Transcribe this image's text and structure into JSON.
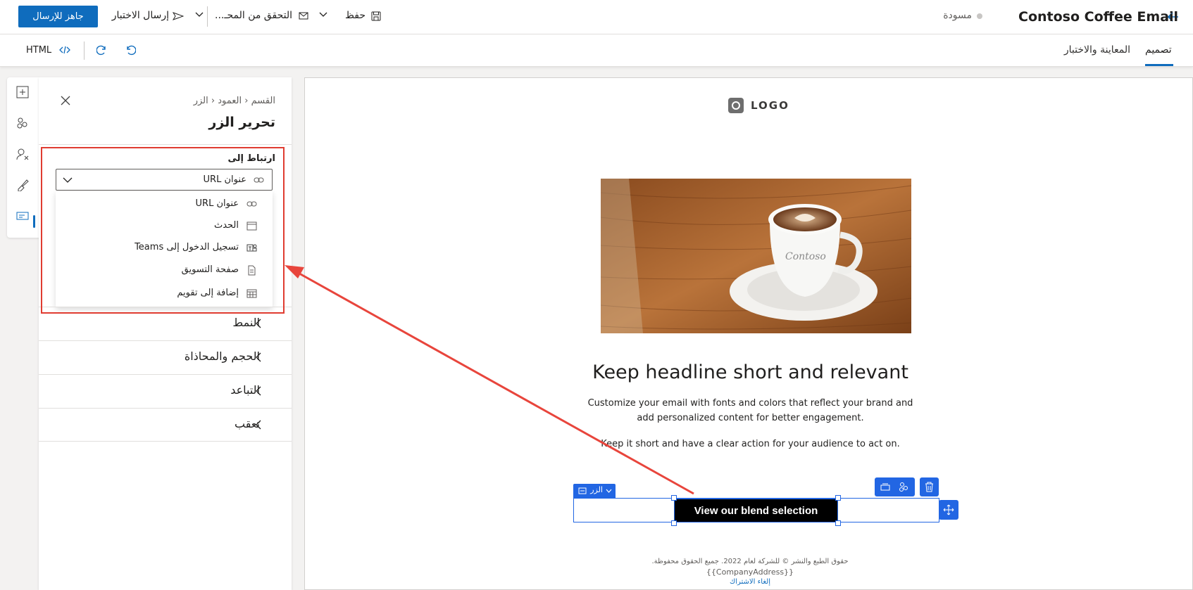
{
  "header": {
    "title": "Contoso Coffee Email",
    "status": "مسودة",
    "save_label": "حفظ",
    "check_label": "التحقق من المحـ...",
    "send_test_label": "إرسال الاختبار",
    "ready_label": "جاهز للإرسال"
  },
  "tabs": {
    "design": "تصميم",
    "preview": "المعاينة والاختبار"
  },
  "toolbar": {
    "html_label": "HTML"
  },
  "panel": {
    "breadcrumb": {
      "section": "القسم",
      "column": "العمود",
      "button": "الزر"
    },
    "title": "تحرير الزر",
    "link_to_label": "ارتباط إلى",
    "selected_value": "عنوان URL",
    "options": [
      {
        "label": "عنوان URL",
        "icon": "link-icon"
      },
      {
        "label": "الحدث",
        "icon": "calendar-icon"
      },
      {
        "label": "تسجيل الدخول إلى Teams",
        "icon": "teams-icon"
      },
      {
        "label": "صفحة التسويق",
        "icon": "document-icon"
      },
      {
        "label": "إضافة إلى تقويم",
        "icon": "calendar-grid-icon"
      }
    ],
    "sections": [
      "النمط",
      "الحجم والمحاذاة",
      "التباعد",
      "تعقب"
    ]
  },
  "email": {
    "logo_text": "LOGO",
    "headline": "Keep headline short and relevant",
    "body1": "Customize your email with fonts and colors that reflect your brand and add personalized content for better engagement.",
    "body2": "Keep it short and have a clear action for your audience to act on.",
    "button_label": "View our blend selection",
    "element_tag": "الزر",
    "footer_copyright": "حقوق الطبع والنشر © للشركة لعام 2022. جميع الحقوق محفوظة.",
    "footer_address": "{{CompanyAddress}}",
    "footer_unsubscribe": "إلغاء الاشتراك"
  },
  "colors": {
    "primary": "#0f6cbd",
    "selection": "#2266e3",
    "highlight_box": "#e03c31",
    "arrow": "#e8453c",
    "email_button_bg": "#000000"
  }
}
